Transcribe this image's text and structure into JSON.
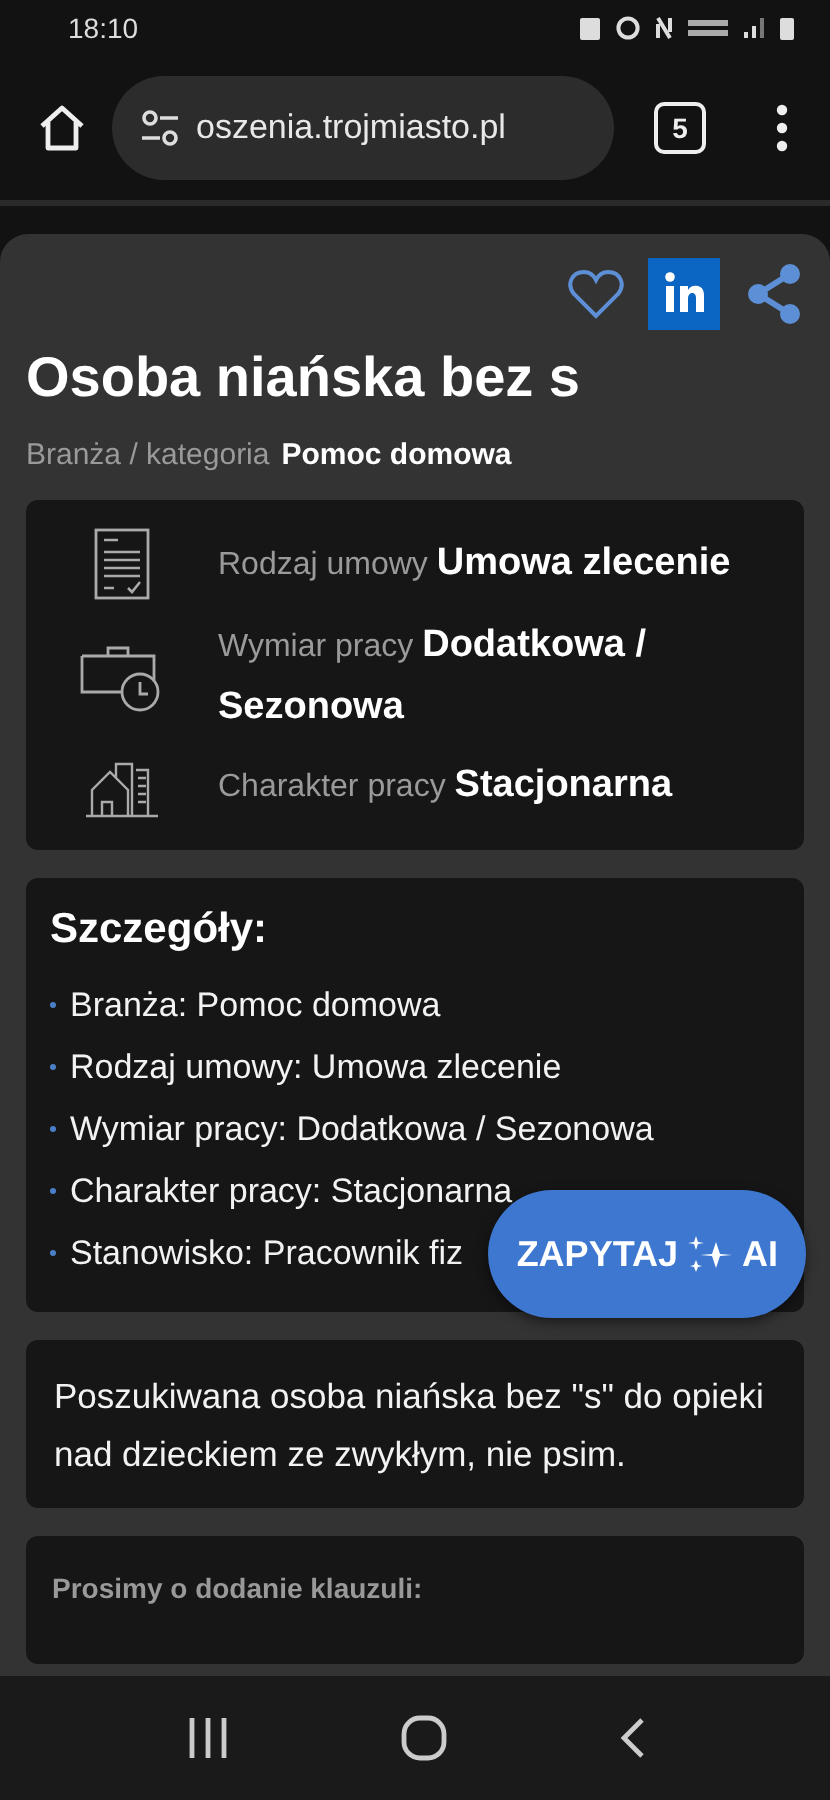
{
  "status_bar": {
    "time": "18:10"
  },
  "browser": {
    "url": "oszenia.trojmiasto.pl",
    "tab_count": "5"
  },
  "listing": {
    "title": "Osoba niańska bez s",
    "category_label": "Branża / kategoria",
    "category_value": "Pomoc domowa",
    "facts": [
      {
        "kind": "document",
        "label": "Rodzaj umowy",
        "value": "Umowa zlecenie"
      },
      {
        "kind": "schedule",
        "label": "Wymiar pracy",
        "value": "Dodatkowa / Sezonowa"
      },
      {
        "kind": "building",
        "label": "Charakter pracy",
        "value": "Stacjonarna"
      }
    ],
    "details": {
      "heading": "Szczegóły:",
      "items": [
        "Branża: Pomoc domowa",
        "Rodzaj umowy: Umowa zlecenie",
        "Wymiar pracy: Dodatkowa / Sezonowa",
        "Charakter pracy: Stacjonarna",
        "Stanowisko: Pracownik fiz"
      ]
    },
    "description": "Poszukiwana osoba niańska bez \"s\" do opieki nad dzieckiem ze zwykłym, nie psim.",
    "clause_heading": "Prosimy o dodanie klauzuli:"
  },
  "ask_button": {
    "label": "ZAPYTAJ",
    "badge": "AI"
  }
}
